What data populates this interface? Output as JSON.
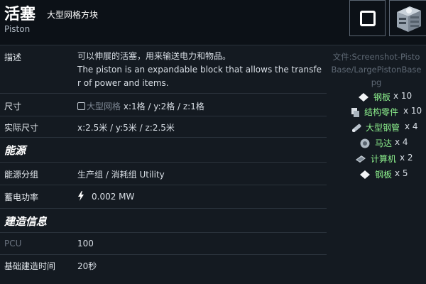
{
  "header": {
    "title": "活塞",
    "subtitle_cn": "大型网格方块",
    "subtitle_en": "Piston",
    "square_icon": "square-outline-icon",
    "block_icon": "piston-block-icon"
  },
  "rows": {
    "description": {
      "label": "描述",
      "line1": "可以伸展的活塞，用来输送电力和物品。",
      "line2": "The piston is an expandable block that allows the transfe",
      "line3": "r of power and items."
    },
    "size": {
      "label": "尺寸",
      "grid": "大型网格",
      "dims": "x:1格 / y:2格 / z:1格"
    },
    "actual_size": {
      "label": "实际尺寸",
      "value": "x:2.5米 / y:5米 / z:2.5米"
    },
    "energy_section": "能源",
    "power_group": {
      "label": "能源分组",
      "value": "生产组 / 消耗组 Utility"
    },
    "power_storage": {
      "label": "蓄电功率",
      "value": "0.002 MW",
      "icon": "lightning-icon"
    },
    "build_section": "建造信息",
    "pcu": {
      "label": "PCU",
      "value": "100"
    },
    "build_time": {
      "label": "基础建造时间",
      "value": "20秒"
    }
  },
  "side": {
    "file_line1": "文件:Screenshot-Pisto",
    "file_line2": "Base/LargePistonBase",
    "file_line3": "pg",
    "materials": [
      {
        "name": "钢板",
        "qty": "x 10",
        "icon": "steel-plate-icon"
      },
      {
        "name": "结构零件",
        "qty": "x 10",
        "icon": "construction-component-icon"
      },
      {
        "name": "大型钢管",
        "qty": "x 4",
        "icon": "large-steel-tube-icon"
      },
      {
        "name": "马达",
        "qty": "x 4",
        "icon": "motor-icon"
      },
      {
        "name": "计算机",
        "qty": "x 2",
        "icon": "computer-icon"
      },
      {
        "name": "钢板",
        "qty": "x 5",
        "icon": "steel-plate-icon"
      }
    ]
  },
  "colors": {
    "background": "#141a21",
    "header_background": "#0c1117",
    "material_name": "#8ef38e",
    "divider": "#2a323b"
  }
}
